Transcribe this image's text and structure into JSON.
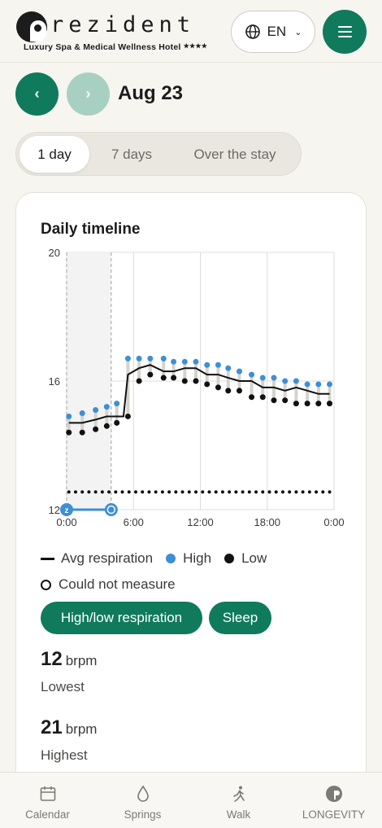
{
  "header": {
    "logo_word": "rezident",
    "logo_tagline": "Luxury Spa & Medical Wellness Hotel",
    "logo_stars": "★★★★",
    "language": "EN"
  },
  "date_nav": {
    "title": "Aug 23"
  },
  "range_tabs": [
    "1 day",
    "7 days",
    "Over the stay"
  ],
  "card": {
    "title": "Daily timeline",
    "legend": {
      "avg": "Avg respiration",
      "high": "High",
      "low": "Low",
      "no_measure": "Could not measure"
    },
    "chips": [
      "High/low respiration",
      "Sleep"
    ],
    "stats": [
      {
        "value": "12",
        "unit": "brpm",
        "label": "Lowest"
      },
      {
        "value": "21",
        "unit": "brpm",
        "label": "Highest"
      }
    ]
  },
  "chart_data": {
    "type": "line",
    "title": "Daily timeline",
    "y_ticks": [
      "20",
      "16",
      "12"
    ],
    "x_ticks": [
      "0:00",
      "6:00",
      "12:00",
      "18:00",
      "0:00"
    ],
    "ylim": [
      12,
      20
    ],
    "xlim": [
      0,
      24
    ],
    "sleep_window": [
      0,
      4
    ],
    "x": [
      0,
      0.67,
      1.33,
      2.0,
      2.67,
      3.33,
      4.0,
      4.67,
      5.33,
      6.0,
      6.67,
      7.33,
      8.0,
      8.67,
      9.33,
      10.0,
      10.67,
      11.33,
      12.0,
      12.67,
      13.33,
      14.0,
      14.67,
      15.33,
      16.0,
      16.67,
      17.33,
      18.0,
      18.67,
      19.33,
      20.0,
      20.67,
      21.33,
      22.0,
      22.67,
      23.33
    ],
    "series": [
      {
        "name": "High",
        "color": "#3d8fd6",
        "x": [
          0.2,
          1.4,
          2.6,
          3.6,
          4.5,
          5.5,
          6.5,
          7.5,
          8.7,
          9.6,
          10.6,
          11.6,
          12.6,
          13.6,
          14.5,
          15.5,
          16.6,
          17.6,
          18.6,
          19.6,
          20.6,
          21.6,
          22.6,
          23.6
        ],
        "values": [
          14.9,
          15.0,
          15.1,
          15.2,
          15.3,
          16.7,
          16.7,
          16.7,
          16.7,
          16.6,
          16.6,
          16.6,
          16.5,
          16.5,
          16.4,
          16.3,
          16.2,
          16.1,
          16.1,
          16.0,
          16.0,
          15.9,
          15.9,
          15.9
        ]
      },
      {
        "name": "Low",
        "color": "#111111",
        "x": [
          0.2,
          1.4,
          2.6,
          3.6,
          4.5,
          5.5,
          6.5,
          7.5,
          8.7,
          9.6,
          10.6,
          11.6,
          12.6,
          13.6,
          14.5,
          15.5,
          16.6,
          17.6,
          18.6,
          19.6,
          20.6,
          21.6,
          22.6,
          23.6
        ],
        "values": [
          14.4,
          14.4,
          14.5,
          14.6,
          14.7,
          14.9,
          16.0,
          16.2,
          16.1,
          16.1,
          16.0,
          16.0,
          15.9,
          15.8,
          15.7,
          15.7,
          15.5,
          15.5,
          15.4,
          15.4,
          15.3,
          15.3,
          15.3,
          15.3
        ]
      },
      {
        "name": "Avg respiration",
        "color": "#111111",
        "x": [
          0.2,
          1.4,
          2.6,
          3.6,
          4.5,
          5.1,
          5.5,
          6.5,
          7.5,
          8.7,
          9.6,
          10.6,
          11.6,
          12.6,
          13.6,
          14.5,
          15.5,
          16.6,
          17.6,
          18.6,
          19.6,
          20.6,
          21.6,
          22.6,
          23.6
        ],
        "values": [
          14.7,
          14.7,
          14.8,
          14.9,
          14.9,
          14.9,
          16.2,
          16.4,
          16.5,
          16.3,
          16.3,
          16.4,
          16.4,
          16.2,
          16.2,
          16.1,
          16.0,
          16.0,
          15.8,
          15.8,
          15.7,
          15.8,
          15.7,
          15.6,
          15.6
        ]
      },
      {
        "name": "Could not measure",
        "color": "#111111",
        "x": [
          0.2,
          0.8,
          1.4,
          2.0,
          2.6,
          3.2,
          3.8,
          4.4,
          5.0,
          5.6,
          6.2,
          6.8,
          7.4,
          8.0,
          8.6,
          9.2,
          9.8,
          10.4,
          11.0,
          11.6,
          12.2,
          12.8,
          13.4,
          14.0,
          14.6,
          15.2,
          15.8,
          16.4,
          17.0,
          17.6,
          18.2,
          18.8,
          19.4,
          20.0,
          20.6,
          21.2,
          21.8,
          22.4,
          23.0,
          23.6
        ],
        "values": [
          12.55,
          12.55,
          12.55,
          12.55,
          12.55,
          12.55,
          12.55,
          12.55,
          12.55,
          12.55,
          12.55,
          12.55,
          12.55,
          12.55,
          12.55,
          12.55,
          12.55,
          12.55,
          12.55,
          12.55,
          12.55,
          12.55,
          12.55,
          12.55,
          12.55,
          12.55,
          12.55,
          12.55,
          12.55,
          12.55,
          12.55,
          12.55,
          12.55,
          12.55,
          12.55,
          12.55,
          12.55,
          12.55,
          12.55,
          12.55
        ]
      }
    ]
  },
  "bottom_nav": [
    {
      "label": "Calendar",
      "icon": "calendar-icon"
    },
    {
      "label": "Springs",
      "icon": "drop-icon"
    },
    {
      "label": "Walk",
      "icon": "walker-icon"
    },
    {
      "label": "LONGEVITY",
      "icon": "longevity-icon"
    }
  ],
  "colors": {
    "brand": "#0f7a5c",
    "brand_light": "#a8d0c2",
    "high": "#3d8fd6",
    "low": "#111111"
  }
}
